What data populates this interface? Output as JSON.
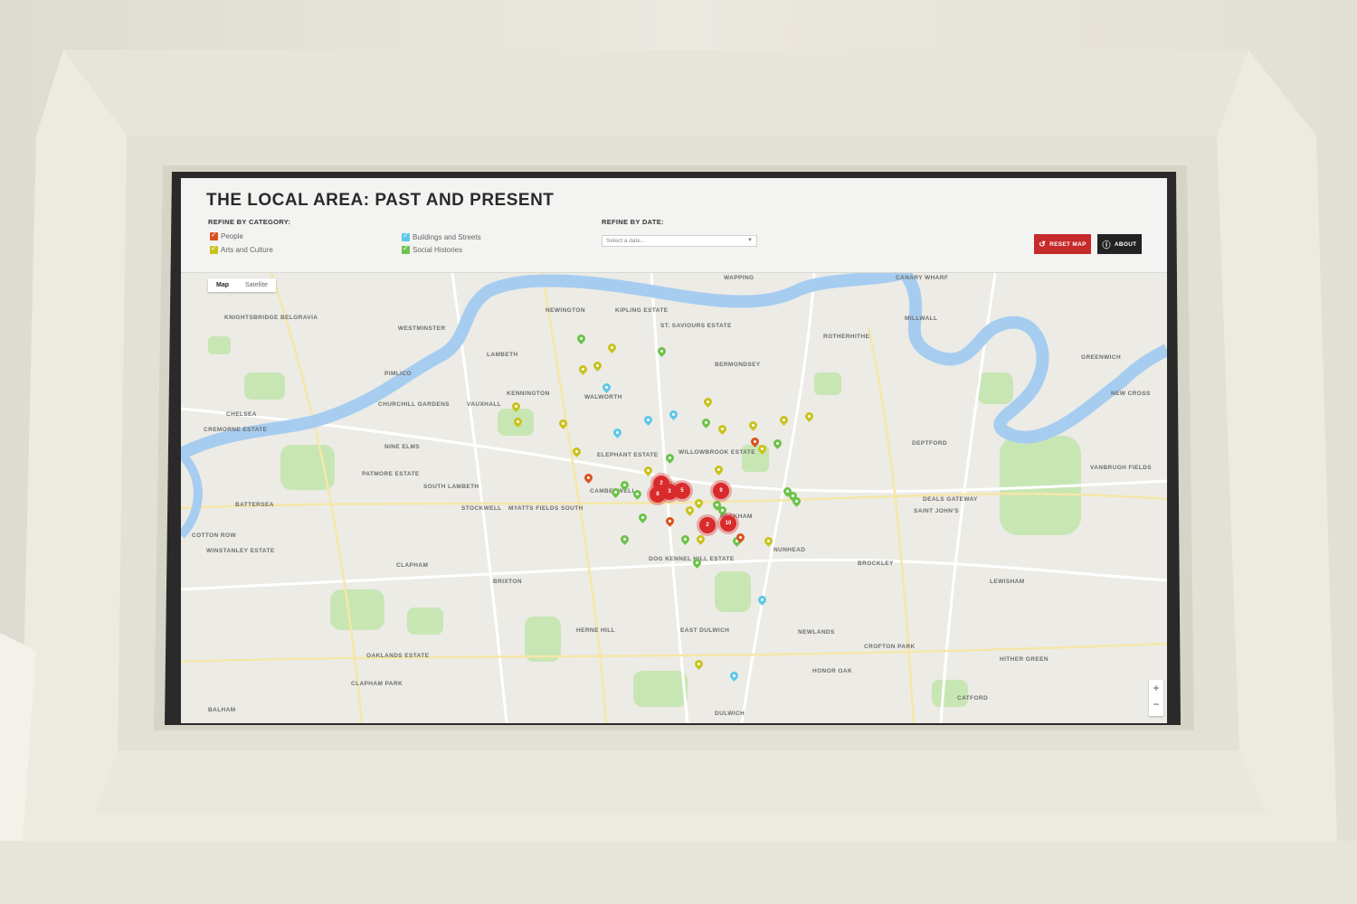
{
  "header": {
    "title": "THE LOCAL AREA: PAST AND PRESENT",
    "category_label": "REFINE BY CATEGORY:",
    "date_label": "REFINE BY DATE:",
    "date_placeholder": "Select a date...",
    "categories": [
      {
        "label": "People",
        "color": "#d9531e"
      },
      {
        "label": "Arts and Culture",
        "color": "#c9c21c"
      },
      {
        "label": "Buildings and Streets",
        "color": "#5cc8e8"
      },
      {
        "label": "Social Histories",
        "color": "#6cc24a"
      }
    ],
    "reset_label": "RESET MAP",
    "about_label": "ABOUT",
    "reset_color": "#c72a2a",
    "about_color": "#222222"
  },
  "map": {
    "type_map": "Map",
    "type_satellite": "Satellite",
    "zoom_in": "+",
    "zoom_out": "−",
    "places": [
      "KNIGHTSBRIDGE",
      "BELGRAVIA",
      "WESTMINSTER",
      "NEWINGTON",
      "KIPLING ESTATE",
      "ST. SAVIOURS ESTATE",
      "BERMONDSEY",
      "ROTHERHITHE",
      "MILLWALL",
      "PIMLICO",
      "LAMBETH",
      "WALWORTH",
      "KENNINGTON",
      "VAUXHALL",
      "CHELSEA",
      "CHURCHILL GARDENS",
      "CREMORNE ESTATE",
      "NINE ELMS",
      "ELEPHANT ESTATE",
      "WILLOWBROOK ESTATE",
      "DEPTFORD",
      "GREENWICH",
      "NEW CROSS",
      "PATMORE ESTATE",
      "SOUTH LAMBETH",
      "BATTERSEA",
      "STOCKWELL",
      "MYATTS FIELDS SOUTH",
      "CAMBERWELL",
      "PECKHAM",
      "NUNHEAD",
      "SAINT JOHN'S",
      "DEALS GATEWAY",
      "COTTON ROW",
      "WINSTANLEY ESTATE",
      "CLAPHAM",
      "BRIXTON",
      "DOG KENNEL HILL ESTATE",
      "BROCKLEY",
      "LEWISHAM",
      "HERNE HILL",
      "EAST DULWICH",
      "NEWLANDS",
      "CROFTON PARK",
      "HONOR OAK",
      "HITHER GREEN",
      "OAKLANDS ESTATE",
      "CLAPHAM PARK",
      "BALHAM",
      "DULWICH",
      "CATFORD",
      "VANBRUGH FIELDS",
      "CANARY WHARF",
      "WAPPING"
    ],
    "clusters": [
      "2",
      "8",
      "3",
      "5",
      "9",
      "2",
      "10"
    ]
  }
}
